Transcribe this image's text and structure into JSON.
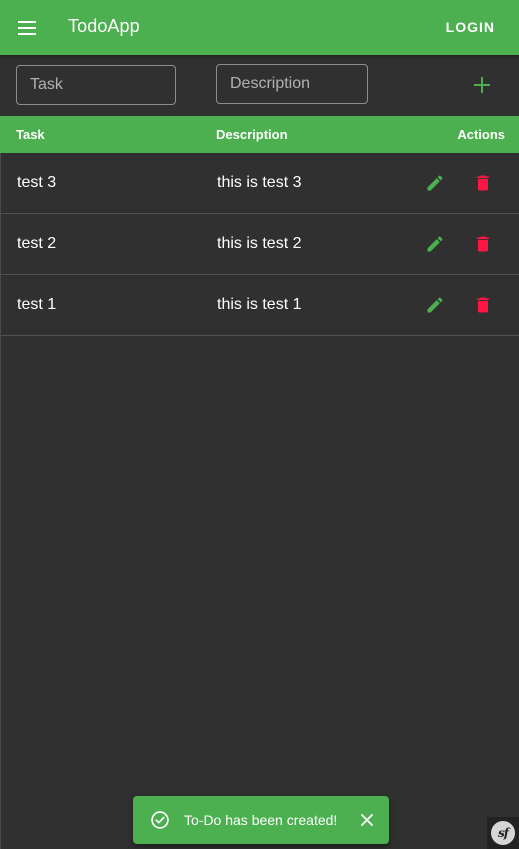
{
  "appbar": {
    "title": "TodoApp",
    "menu_icon": "menu-icon",
    "login_label": "LOGIN",
    "color": "#4caf50"
  },
  "form": {
    "task_placeholder": "Task",
    "task_value": "",
    "description_placeholder": "Description",
    "description_value": "",
    "add_icon": "plus-icon"
  },
  "table": {
    "headers": {
      "task": "Task",
      "description": "Description",
      "actions": "Actions"
    },
    "rows": [
      {
        "task": "test 3",
        "description": "this is test 3"
      },
      {
        "task": "test 2",
        "description": "this is test 2"
      },
      {
        "task": "test 1",
        "description": "this is test 1"
      }
    ],
    "edit_icon": "pencil-icon",
    "delete_icon": "trash-icon",
    "edit_color": "#4caf50",
    "delete_color": "#ff1744"
  },
  "snackbar": {
    "message": "To-Do has been created!",
    "status_icon": "check-circle-icon",
    "close_icon": "close-icon"
  },
  "debug_badge": {
    "icon": "symfony-logo-icon",
    "label": "sf"
  }
}
